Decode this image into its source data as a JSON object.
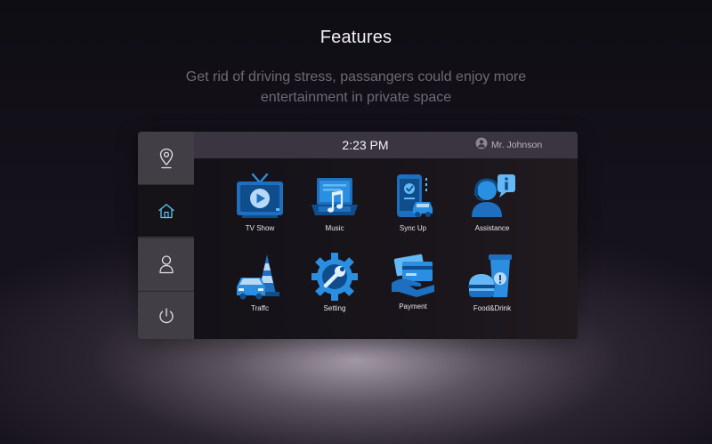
{
  "page": {
    "heading": "Features",
    "subtitle_line1": "Get rid of driving stress, passangers could enjoy more",
    "subtitle_line2": "entertainment in private space"
  },
  "status_bar": {
    "time": "2:23 PM",
    "user_name": "Mr. Johnson"
  },
  "sidebar": {
    "items": [
      {
        "name": "location",
        "icon": "location-pin-icon",
        "active": false
      },
      {
        "name": "home",
        "icon": "home-icon",
        "active": true
      },
      {
        "name": "profile",
        "icon": "person-icon",
        "active": false
      },
      {
        "name": "power",
        "icon": "power-icon",
        "active": false
      }
    ]
  },
  "apps": [
    {
      "label": "TV Show",
      "icon": "tv-icon"
    },
    {
      "label": "Music",
      "icon": "music-laptop-icon"
    },
    {
      "label": "Sync Up",
      "icon": "phone-car-sync-icon"
    },
    {
      "label": "Assistance",
      "icon": "support-agent-icon"
    },
    {
      "label": "Traffc",
      "icon": "traffic-cone-car-icon"
    },
    {
      "label": "Setting",
      "icon": "gear-wrench-icon"
    },
    {
      "label": "Payment",
      "icon": "card-payment-icon"
    },
    {
      "label": "Food&Drink",
      "icon": "burger-cup-icon"
    }
  ],
  "colors": {
    "icon_blue": "#2a8fe0",
    "icon_light": "#63b8f5",
    "icon_dark": "#0f4d8c",
    "sidebar": "#423e46",
    "sidebar_active": "#151218",
    "active_icon": "#5dc6f2"
  }
}
